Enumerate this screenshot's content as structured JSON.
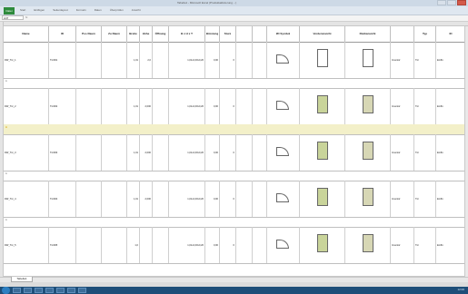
{
  "window": {
    "title": "Tabelle1 - Microsoft Excel (Produktaktivierung ...)"
  },
  "ribbon": {
    "file_label": "Datei",
    "tabs": [
      "Start",
      "Einfügen",
      "Seitenlayout",
      "Formeln",
      "Daten",
      "Überprüfen",
      "Ansicht"
    ]
  },
  "formula_bar": {
    "name_box": "A47",
    "fx": "fx"
  },
  "table": {
    "headers": [
      "Name",
      "ID",
      "Pos Raum",
      "Zu Raum",
      "Breite",
      "Höhe",
      "Öffnung",
      "B x H x T",
      "Brüstung",
      "Sturz",
      "",
      "",
      "2D Symbol",
      "Vorderansicht",
      "Rückansicht",
      "",
      "Typ",
      "ID"
    ],
    "rows": [
      {
        "name": "DW_Tür_1",
        "id": "Tür001",
        "breite": "1,01",
        "hoehe": "2,0",
        "bht": "1,01x2,00x0,20",
        "bru": "0,00",
        "sturz": "0",
        "info": "Innentür",
        "typ": "Tür",
        "extra": "Einflü"
      },
      {
        "name": "DW_Tür_2",
        "id": "Tür002",
        "breite": "1,01",
        "hoehe": "2,000",
        "bht": "1,01x2,00x0,20",
        "bru": "0,00",
        "sturz": "0",
        "info": "Innentür",
        "typ": "Tür",
        "extra": "Einflü"
      },
      {
        "name": "DW_Tür_3",
        "id": "Tür003",
        "breite": "1,01",
        "hoehe": "2,000",
        "bht": "1,01x2,00x0,20",
        "bru": "0,00",
        "sturz": "0",
        "info": "Innentür",
        "typ": "Tür",
        "extra": "Einflü"
      },
      {
        "name": "DW_Tür_4",
        "id": "Tür004",
        "breite": "1,01",
        "hoehe": "2,000",
        "bht": "1,01x2,00x0,20",
        "bru": "0,00",
        "sturz": "0",
        "info": "Innentür",
        "typ": "Tür",
        "extra": "Einflü"
      },
      {
        "name": "DW_Tür_5",
        "id": "Tür005",
        "breite": "1,0",
        "hoehe": "",
        "bht": "1,01x2,00x0,20",
        "bru": "0,00",
        "sturz": "0",
        "info": "Innentür",
        "typ": "Tür",
        "extra": "Einflü"
      }
    ],
    "gap_marks": [
      "A",
      "A",
      "A",
      "A"
    ]
  },
  "sheet": {
    "tab": "Tabelle1"
  },
  "taskbar": {
    "clock": "12:00"
  }
}
